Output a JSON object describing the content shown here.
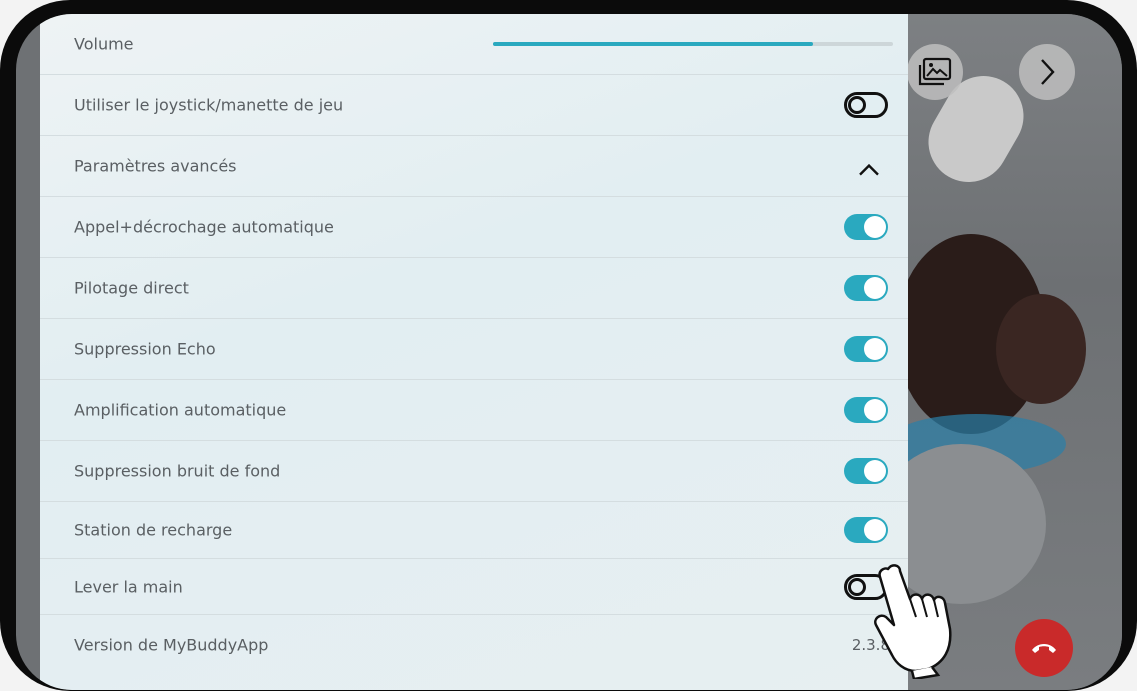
{
  "settings": {
    "volume_label": "Volume",
    "volume_level": 0.8,
    "rows": [
      {
        "label": "Utiliser le joystick/manette de jeu",
        "state": "off"
      },
      {
        "label": "Paramètres avancés",
        "state": "expanded"
      },
      {
        "label": "Appel+décrochage automatique",
        "state": "on"
      },
      {
        "label": "Pilotage direct",
        "state": "on"
      },
      {
        "label": "Suppression Echo",
        "state": "on"
      },
      {
        "label": "Amplification automatique",
        "state": "on"
      },
      {
        "label": "Suppression bruit de fond",
        "state": "on"
      },
      {
        "label": "Station de recharge",
        "state": "on"
      },
      {
        "label": "Lever la main",
        "state": "off"
      }
    ],
    "version_label": "Version de MyBuddyApp",
    "version_value": "2.3.8"
  },
  "icons": {
    "gallery": "image-gallery-icon",
    "next": "chevron-right-icon",
    "hangup": "phone-hangup-icon",
    "collapse": "chevron-up-icon",
    "pointer": "hand-pointer-icon"
  },
  "colors": {
    "accent": "#2aa9bf",
    "hangup": "#c92a2a"
  }
}
